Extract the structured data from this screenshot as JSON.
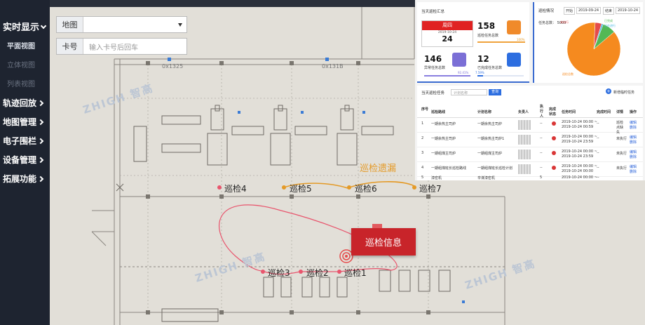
{
  "sidebar": {
    "items": [
      {
        "label": "实时显示",
        "type": "group",
        "expanded": true
      },
      {
        "label": "平面视图",
        "type": "sub",
        "active": true
      },
      {
        "label": "立体视图",
        "type": "sub",
        "active": false
      },
      {
        "label": "列表视图",
        "type": "sub",
        "active": false
      },
      {
        "label": "轨迹回放",
        "type": "group"
      },
      {
        "label": "地图管理",
        "type": "group"
      },
      {
        "label": "电子围栏",
        "type": "group"
      },
      {
        "label": "设备管理",
        "type": "group"
      },
      {
        "label": "拓展功能",
        "type": "group"
      }
    ]
  },
  "filters": {
    "map_label": "地图",
    "map_value": "",
    "card_label": "卡号",
    "card_placeholder": "输入卡号后回车"
  },
  "map": {
    "missed_label": "巡检遗漏",
    "info_badge": "巡检信息",
    "watermark": "ZHIGH 智高",
    "device_labels": [
      "0x1325",
      "0x131B"
    ],
    "points": [
      "巡检1",
      "巡检2",
      "巡检3",
      "巡检4",
      "巡检5",
      "巡检6",
      "巡检7"
    ],
    "colors": {
      "done": "#e8556d",
      "missed": "#e49a27",
      "badge": "#c8242a"
    }
  },
  "overlay": {
    "summary": {
      "title": "当天巡检汇总",
      "weekday": "周四",
      "date": "2019-10-24",
      "day": "24",
      "total_value": "158",
      "total_label": "巡检任务总数",
      "total_pct": "100%",
      "abnormal_value": "146",
      "abnormal_label": "异常任务总数",
      "abnormal_pct": "92.41%",
      "completed_value": "12",
      "completed_label": "已完成任务总数",
      "completed_pct": "7.59%"
    },
    "situation": {
      "title": "巡检情况",
      "start_label": "开始",
      "start_value": "2019-09-24",
      "end_label": "结束",
      "end_value": "2019-10-24",
      "total_text": "任务总数：",
      "total_value": "5000",
      "legend": [
        "未执行",
        "正在进行",
        "已完成",
        "巡检总数"
      ],
      "pie": [
        {
          "name": "未执行",
          "value": 4,
          "color": "#e54b4b"
        },
        {
          "name": "正在进行",
          "value": 1,
          "color": "#49b8e6"
        },
        {
          "name": "已完成",
          "value": 8,
          "color": "#53b855"
        },
        {
          "name": "巡检总数",
          "value": 87,
          "color": "#f58a1f"
        }
      ]
    },
    "tasks": {
      "title": "当天巡检任务",
      "search_placeholder": "计划名称",
      "query_btn": "查询",
      "add_btn": "新增临时任务",
      "headers": [
        "序号",
        "巡检路线",
        "计划名称",
        "负责人",
        "执行人",
        "完成状态",
        "任务时间",
        "完成时间",
        "详情",
        "操作"
      ],
      "rows": [
        {
          "no": "1",
          "route": "一期余热主司炉",
          "plan": "一期余热主司炉",
          "executor": "--",
          "time1": "2019-10-24 00:00 ~",
          "time2": "2019-10-24 00:59",
          "done": "--",
          "detail": "巡检点缺失",
          "op1": "编辑",
          "op2": "删除"
        },
        {
          "no": "2",
          "route": "一期余热主司炉",
          "plan": "一期余热主司炉1",
          "executor": "--",
          "time1": "2019-10-24 00:00 ~",
          "time2": "2019-10-24 23:59",
          "done": "--",
          "detail": "未执行",
          "op1": "编辑",
          "op2": "删除"
        },
        {
          "no": "3",
          "route": "一期组煤主司炉",
          "plan": "一期组煤主司炉",
          "executor": "--",
          "time1": "2019-10-24 00:00 ~",
          "time2": "2019-10-24 23:59",
          "done": "--",
          "detail": "未执行",
          "op1": "编辑",
          "op2": "删除"
        },
        {
          "no": "4",
          "route": "一期组煤班长巡检路线",
          "plan": "一期组煤班长巡检计划",
          "executor": "--",
          "time1": "2019-10-24 00:00 ~",
          "time2": "2019-10-24 00:00",
          "done": "--",
          "detail": "未执行",
          "op1": "编辑",
          "op2": "删除"
        },
        {
          "no": "5",
          "route": "漆密机",
          "plan": "辛谋漆密机",
          "executor": "5",
          "time1": "2019-10-24 00:00 ~",
          "time2": "",
          "done": "--",
          "detail": "",
          "op1": "",
          "op2": ""
        }
      ]
    }
  }
}
